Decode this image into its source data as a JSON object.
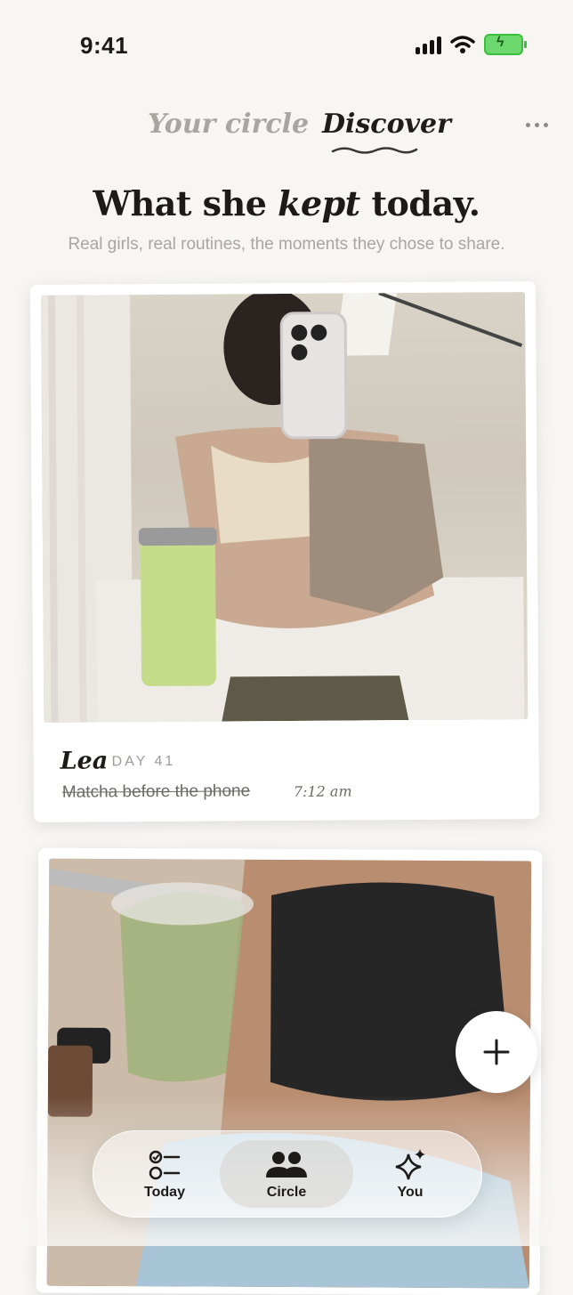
{
  "status": {
    "time": "9:41"
  },
  "tabs": [
    {
      "label": "Your circle",
      "active": false
    },
    {
      "label": "Discover",
      "active": true
    }
  ],
  "heading": {
    "before": "What she ",
    "emphasis": "kept",
    "after": " today."
  },
  "subheading": "Real girls, real routines, the moments they chose to share.",
  "posts": [
    {
      "name": "Lea",
      "day": "DAY 41",
      "note": "Matcha before the phone",
      "time": "7:12 am"
    },
    {
      "name": "",
      "day": "",
      "note": "",
      "time": ""
    }
  ],
  "fab_icon": "plus-icon",
  "nav": [
    {
      "label": "Today",
      "icon": "checklist-icon",
      "active": false
    },
    {
      "label": "Circle",
      "icon": "people-icon",
      "active": true
    },
    {
      "label": "You",
      "icon": "sparkles-icon",
      "active": false
    }
  ],
  "colors": {
    "background": "#f7f6f3",
    "active_tab": "#1f1d1b",
    "inactive_tab": "#a9a6a1",
    "battery": "#3bbf3b"
  }
}
